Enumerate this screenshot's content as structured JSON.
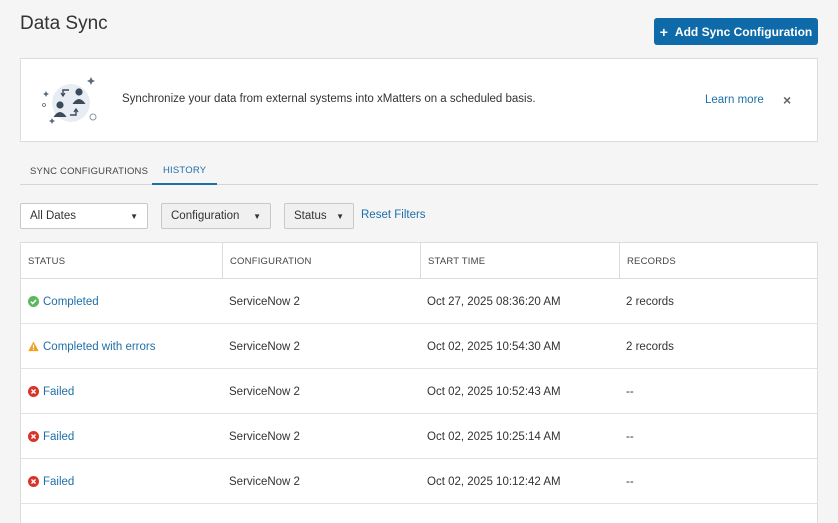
{
  "header": {
    "title": "Data Sync",
    "add_button_label": "Add Sync Configuration"
  },
  "banner": {
    "text": "Synchronize your data from external systems into xMatters on a scheduled basis.",
    "learn_more": "Learn more",
    "close": "×"
  },
  "tabs": [
    {
      "label": "SYNC CONFIGURATIONS",
      "active": false
    },
    {
      "label": "HISTORY",
      "active": true
    }
  ],
  "filters": {
    "dates": "All Dates",
    "configuration": "Configuration",
    "status": "Status",
    "reset": "Reset Filters"
  },
  "table": {
    "columns": [
      "STATUS",
      "CONFIGURATION",
      "START TIME",
      "RECORDS"
    ],
    "rows": [
      {
        "status": "Completed",
        "status_icon": "check-circle-icon",
        "configuration": "ServiceNow 2",
        "start_time": "Oct 27, 2025 08:36:20 AM",
        "records": "2 records"
      },
      {
        "status": "Completed with errors",
        "status_icon": "warning-triangle-icon",
        "configuration": "ServiceNow 2",
        "start_time": "Oct 02, 2025 10:54:30 AM",
        "records": "2 records"
      },
      {
        "status": "Failed",
        "status_icon": "error-circle-icon",
        "configuration": "ServiceNow 2",
        "start_time": "Oct 02, 2025 10:52:43 AM",
        "records": "--"
      },
      {
        "status": "Failed",
        "status_icon": "error-circle-icon",
        "configuration": "ServiceNow 2",
        "start_time": "Oct 02, 2025 10:25:14 AM",
        "records": "--"
      },
      {
        "status": "Failed",
        "status_icon": "error-circle-icon",
        "configuration": "ServiceNow 2",
        "start_time": "Oct 02, 2025 10:12:42 AM",
        "records": "--"
      }
    ]
  },
  "colors": {
    "accent": "#0e6aa8",
    "link": "#1f6fa8",
    "success": "#5cb85c",
    "warning": "#f0a020",
    "error": "#d9342b"
  }
}
